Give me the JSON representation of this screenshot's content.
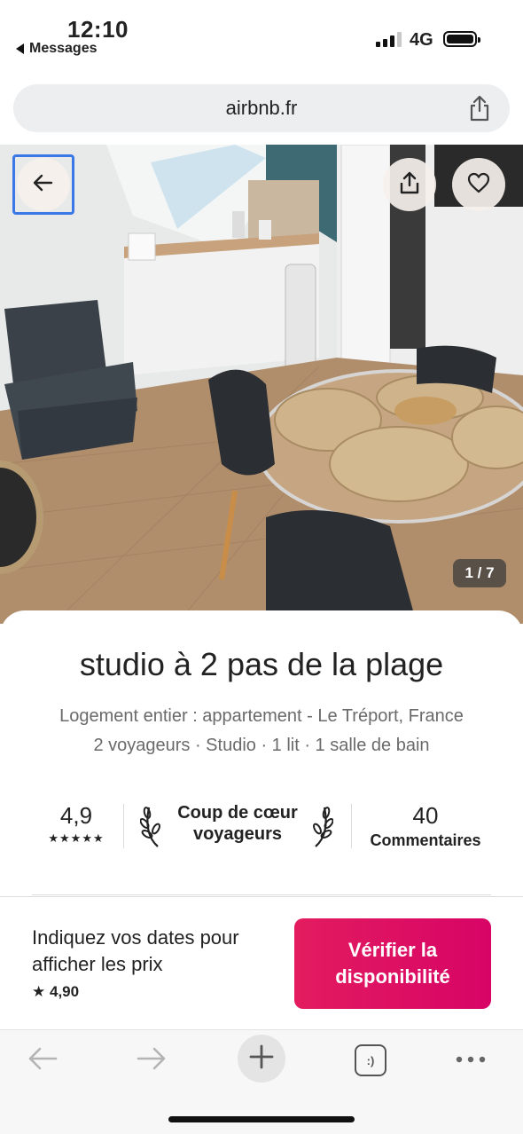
{
  "status_bar": {
    "time": "12:10",
    "back_app": "Messages",
    "network": "4G",
    "signal_bars_active": 3,
    "battery_level": 1.0
  },
  "url_bar": {
    "domain": "airbnb.fr",
    "share_icon": "share-icon"
  },
  "gallery": {
    "back_icon": "arrow-left-icon",
    "share_icon": "share-icon",
    "favorite_icon": "heart-icon",
    "counter": "1 / 7"
  },
  "listing": {
    "title": "studio à 2 pas de la plage",
    "subtitle_line1": "Logement entier : appartement - Le Tréport, France",
    "subtitle_line2": "2 voyageurs · Studio · 1 lit · 1 salle de bain",
    "rating": "4,9",
    "stars": "★★★★★",
    "badge_line1": "Coup de cœur",
    "badge_line2": "voyageurs",
    "review_count": "40",
    "review_label": "Commentaires"
  },
  "reservation": {
    "prompt": "Indiquez vos dates pour afficher les prix",
    "rating": "4,90",
    "button_line1": "Vérifier la",
    "button_line2": "disponibilité",
    "button_color": "#e31c5f"
  },
  "browser_toolbar": {
    "items": [
      "arrow-left-icon",
      "arrow-right-icon",
      "plus-icon",
      "tabs-icon",
      "more-icon"
    ],
    "tabs_glyph": ":)"
  }
}
